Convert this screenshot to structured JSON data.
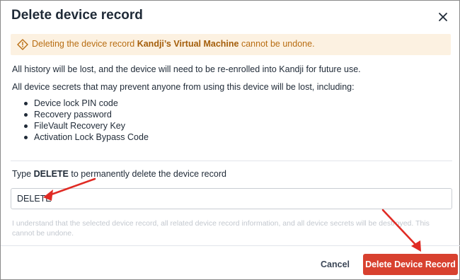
{
  "dialog": {
    "title": "Delete device record",
    "close_icon": "close-icon"
  },
  "warning": {
    "icon": "warning-diamond-icon",
    "prefix": "Deleting the device record ",
    "device_name": "Kandji’s Virtual Machine",
    "suffix": " cannot be undone."
  },
  "body": {
    "paragraph1": "All history will be lost, and the device will need to be re-enrolled into Kandji for future use.",
    "paragraph2": "All device secrets that may prevent anyone from using this device will be lost, including:",
    "secrets": [
      "Device lock PIN code",
      "Recovery password",
      "FileVault Recovery Key",
      "Activation Lock Bypass Code"
    ]
  },
  "confirm": {
    "label_prefix": "Type ",
    "label_keyword": "DELETE",
    "label_suffix": " to permanently delete the device record",
    "input_value": "DELETE",
    "hint": "I understand that the selected device record, all related device record information, and all device secrets will be destroyed. This cannot be undone."
  },
  "footer": {
    "cancel_label": "Cancel",
    "delete_label": "Delete Device Record"
  },
  "colors": {
    "warning_bg": "#fcf1e1",
    "warning_text": "#b86d12",
    "danger": "#d8412f",
    "annotation_arrow": "#e02b24"
  }
}
